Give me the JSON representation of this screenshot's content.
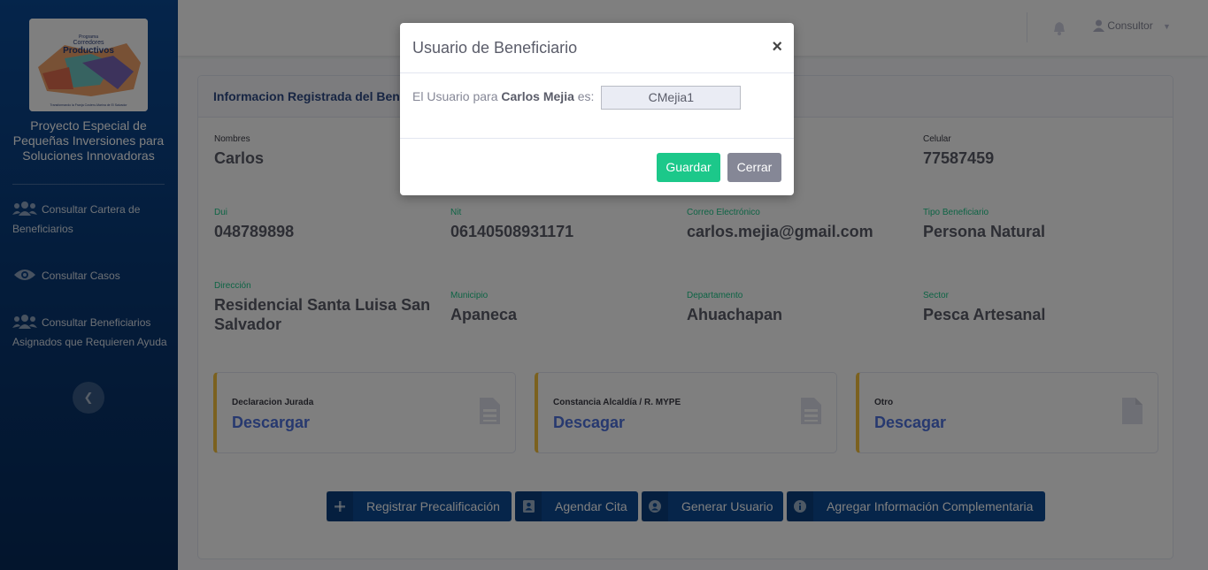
{
  "sidebar": {
    "brand": "Proyecto Especial de Pequeñas Inversiones para Soluciones Innovadoras",
    "logo": {
      "line1": "Programa",
      "line2": "Corredores",
      "line3": "Productivos",
      "tagline": "Transformando la Franja Costero-Marina de El Salvador"
    },
    "items": [
      {
        "label": "Consultar Cartera de Beneficiarios",
        "icon": "users-icon"
      },
      {
        "label": "Consultar Casos",
        "icon": "eye-icon"
      },
      {
        "label": "Consultar Beneficiarios Asignados que Requieren Ayuda",
        "icon": "users-icon"
      }
    ],
    "collapse_icon": "chevron-left-icon"
  },
  "topbar": {
    "user_label": "Consultor",
    "bell_icon": "bell-icon"
  },
  "card": {
    "title": "Informacion Registrada del Beneficiario",
    "fields": [
      {
        "label": "Nombres",
        "value": "Carlos"
      },
      {
        "label": "Celular",
        "value": "77587459"
      },
      {
        "label": "Dui",
        "value": "048789898"
      },
      {
        "label": "Nit",
        "value": "06140508931171"
      },
      {
        "label": "Correo Electrónico",
        "value": "carlos.mejia@gmail.com"
      },
      {
        "label": "Tipo Beneficiario",
        "value": "Persona Natural"
      },
      {
        "label": "Dirección",
        "value": "Residencial Santa Luisa San Salvador"
      },
      {
        "label": "Municipio",
        "value": "Apaneca"
      },
      {
        "label": "Departamento",
        "value": "Ahuachapan"
      },
      {
        "label": "Sector",
        "value": "Pesca Artesanal"
      }
    ],
    "documents": [
      {
        "label": "Declaracion Jurada",
        "link": "Descargar",
        "icon": "file-alt-icon"
      },
      {
        "label": "Constancia Alcaldía / R. MYPE",
        "link": "Descagar",
        "icon": "file-alt-icon"
      },
      {
        "label": "Otro",
        "link": "Descagar",
        "icon": "file-icon"
      }
    ],
    "actions": [
      {
        "label": "Registrar Precalificación",
        "icon": "plus-icon"
      },
      {
        "label": "Agendar Cita",
        "icon": "address-book-icon"
      },
      {
        "label": "Generar Usuario",
        "icon": "user-circle-icon"
      },
      {
        "label": "Agregar Información Complementaria",
        "icon": "info-circle-icon"
      }
    ]
  },
  "modal": {
    "title": "Usuario de Beneficiario",
    "close": "×",
    "text_prefix": "El Usuario para",
    "name": "Carlos Mejia",
    "text_suffix": "es:",
    "username": "CMejia1",
    "save_label": "Guardar",
    "close_label": "Cerrar"
  },
  "colors": {
    "sidebar": "#0b4a96",
    "primary_button": "#0d4a94",
    "save_button": "#1cc88a",
    "close_button": "#858796",
    "label_green": "#1cc88a",
    "link_blue": "#4e73df",
    "doc_border": "#f6c23e"
  }
}
